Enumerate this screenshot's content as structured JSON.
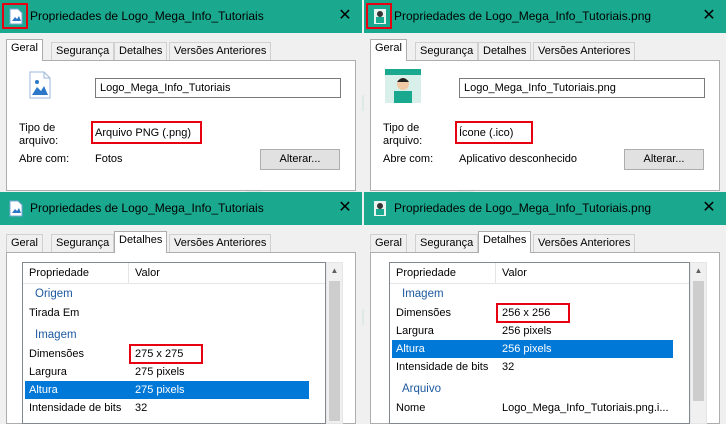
{
  "windows": {
    "tl": {
      "title": "Propriedades de Logo_Mega_Info_Tutoriais",
      "tabs": [
        "Geral",
        "Segurança",
        "Detalhes",
        "Versões Anteriores"
      ],
      "filename": "Logo_Mega_Info_Tutoriais",
      "type_label": "Tipo de\narquivo:",
      "type_value": "Arquivo PNG (.png)",
      "open_label": "Abre com:",
      "open_value": "Fotos",
      "change_btn": "Alterar..."
    },
    "tr": {
      "title": "Propriedades de Logo_Mega_Info_Tutoriais.png",
      "tabs": [
        "Geral",
        "Segurança",
        "Detalhes",
        "Versões Anteriores"
      ],
      "filename": "Logo_Mega_Info_Tutoriais.png",
      "type_label": "Tipo de\narquivo:",
      "type_value": "Ícone (.ico)",
      "open_label": "Abre com:",
      "open_value": "Aplicativo desconhecido",
      "change_btn": "Alterar..."
    },
    "bl": {
      "title": "Propriedades de Logo_Mega_Info_Tutoriais",
      "tabs": [
        "Geral",
        "Segurança",
        "Detalhes",
        "Versões Anteriores"
      ],
      "col_prop": "Propriedade",
      "col_val": "Valor",
      "rows": [
        {
          "group": "Origem"
        },
        {
          "k": "Tirada Em",
          "v": ""
        },
        {
          "group": "Imagem"
        },
        {
          "k": "Dimensões",
          "v": "275 x 275",
          "hl": true
        },
        {
          "k": "Largura",
          "v": "275 pixels"
        },
        {
          "k": "Altura",
          "v": "275 pixels",
          "sel": true
        },
        {
          "k": "Intensidade de bits",
          "v": "32"
        }
      ]
    },
    "br": {
      "title": "Propriedades de Logo_Mega_Info_Tutoriais.png",
      "tabs": [
        "Geral",
        "Segurança",
        "Detalhes",
        "Versões Anteriores"
      ],
      "col_prop": "Propriedade",
      "col_val": "Valor",
      "rows": [
        {
          "group": "Imagem"
        },
        {
          "k": "Dimensões",
          "v": "256 x 256",
          "hl": true
        },
        {
          "k": "Largura",
          "v": "256 pixels"
        },
        {
          "k": "Altura",
          "v": "256 pixels",
          "sel": true
        },
        {
          "k": "Intensidade de bits",
          "v": "32"
        },
        {
          "group": "Arquivo"
        },
        {
          "k": "Nome",
          "v": "Logo_Mega_Info_Tutoriais.png.i..."
        }
      ]
    }
  },
  "colors": {
    "titlebar": "#1aa98e",
    "highlight": "#e60012",
    "selection": "#0078d7"
  },
  "icons": {
    "png": "image-file-icon",
    "ico": "avatar-icon-file",
    "close": "close-icon"
  }
}
